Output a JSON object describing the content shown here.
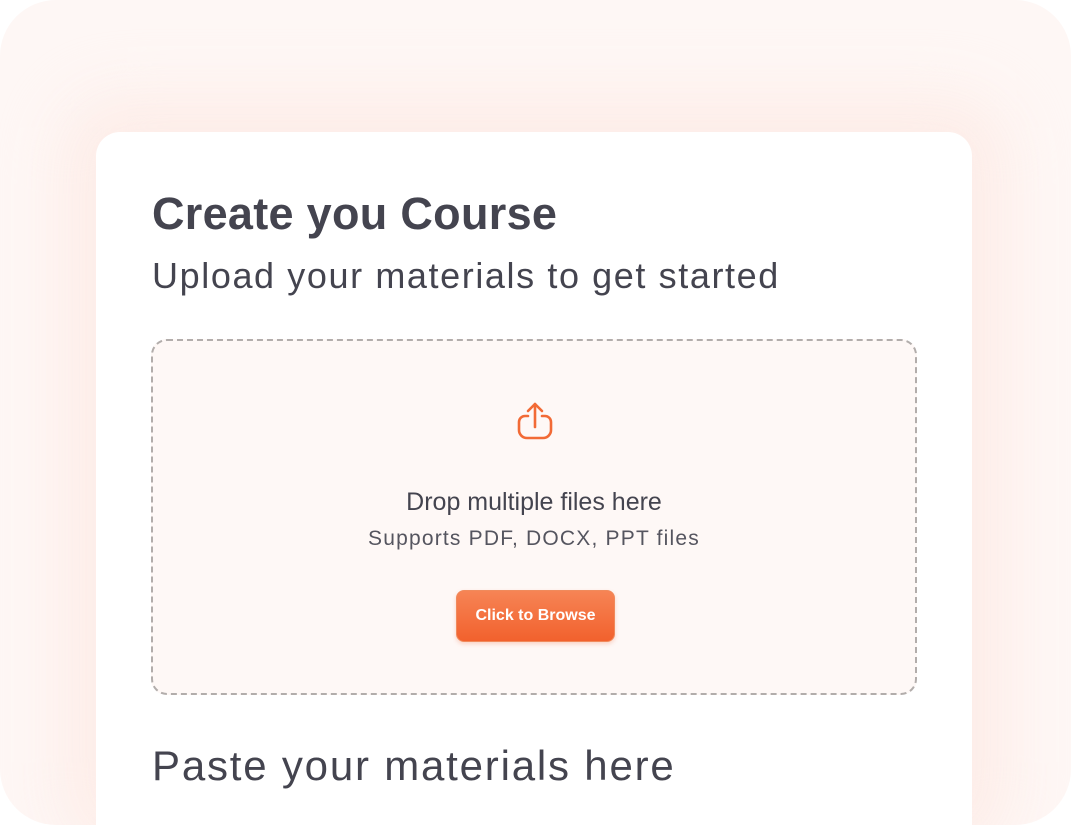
{
  "header": {
    "title": "Create you Course",
    "subtitle": "Upload your materials to get started"
  },
  "upload": {
    "icon": "upload-icon",
    "title": "Drop multiple files here",
    "supported": "Supports PDF, DOCX, PPT files",
    "browse_label": "Click to Browse"
  },
  "paste": {
    "title": "Paste your materials here"
  },
  "colors": {
    "accent": "#f2612d",
    "text": "#44444f",
    "dropzone_border": "#b2adab",
    "dropzone_bg": "#fef8f6"
  }
}
